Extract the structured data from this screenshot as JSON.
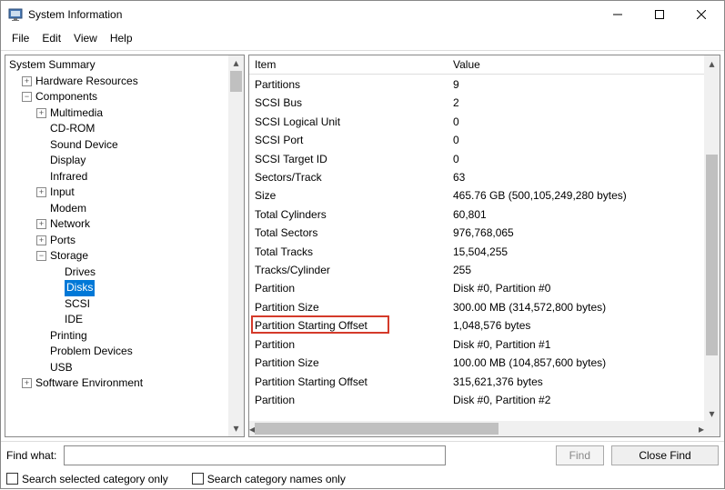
{
  "window": {
    "title": "System Information"
  },
  "menu": {
    "file": "File",
    "edit": "Edit",
    "view": "View",
    "help": "Help"
  },
  "tree": {
    "root": "System Summary",
    "hw": "Hardware Resources",
    "comp": "Components",
    "mm": "Multimedia",
    "cd": "CD-ROM",
    "snd": "Sound Device",
    "disp": "Display",
    "ir": "Infrared",
    "inp": "Input",
    "mod": "Modem",
    "net": "Network",
    "ports": "Ports",
    "stor": "Storage",
    "drv": "Drives",
    "disks": "Disks",
    "scsi": "SCSI",
    "ide": "IDE",
    "print": "Printing",
    "prob": "Problem Devices",
    "usb": "USB",
    "swenv": "Software Environment"
  },
  "cols": {
    "item": "Item",
    "value": "Value"
  },
  "rows": [
    {
      "i": "Partitions",
      "v": "9"
    },
    {
      "i": "SCSI Bus",
      "v": "2"
    },
    {
      "i": "SCSI Logical Unit",
      "v": "0"
    },
    {
      "i": "SCSI Port",
      "v": "0"
    },
    {
      "i": "SCSI Target ID",
      "v": "0"
    },
    {
      "i": "Sectors/Track",
      "v": "63"
    },
    {
      "i": "Size",
      "v": "465.76 GB (500,105,249,280 bytes)"
    },
    {
      "i": "Total Cylinders",
      "v": "60,801"
    },
    {
      "i": "Total Sectors",
      "v": "976,768,065"
    },
    {
      "i": "Total Tracks",
      "v": "15,504,255"
    },
    {
      "i": "Tracks/Cylinder",
      "v": "255"
    },
    {
      "i": "Partition",
      "v": "Disk #0, Partition #0"
    },
    {
      "i": "Partition Size",
      "v": "300.00 MB (314,572,800 bytes)"
    },
    {
      "i": "Partition Starting Offset",
      "v": "1,048,576 bytes"
    },
    {
      "i": "Partition",
      "v": "Disk #0, Partition #1"
    },
    {
      "i": "Partition Size",
      "v": "100.00 MB (104,857,600 bytes)"
    },
    {
      "i": "Partition Starting Offset",
      "v": "315,621,376 bytes"
    },
    {
      "i": "Partition",
      "v": "Disk #0, Partition #2"
    }
  ],
  "find": {
    "label": "Find what:",
    "btn": "Find",
    "close": "Close Find",
    "chk1": "Search selected category only",
    "chk2": "Search category names only"
  },
  "highlight_row_index": 13
}
